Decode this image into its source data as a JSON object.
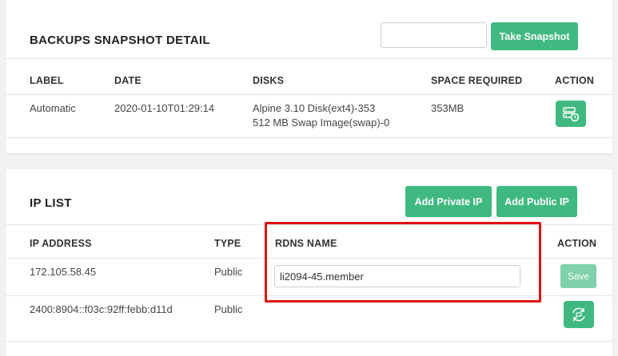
{
  "snapshot": {
    "title": "BACKUPS SNAPSHOT DETAIL",
    "input_value": "",
    "take_snapshot_label": "Take Snapshot",
    "columns": [
      "LABEL",
      "DATE",
      "DISKS",
      "SPACE REQUIRED",
      "ACTION"
    ],
    "rows": [
      {
        "label": "Automatic",
        "date": "2020-01-10T01:29:14",
        "disk_1": "Alpine 3.10 Disk(ext4)-353",
        "disk_2": "512 MB Swap Image(swap)-0",
        "space": "353MB",
        "action_icon": "restore-server-icon"
      }
    ]
  },
  "ip_list": {
    "title": "IP LIST",
    "add_private_label": "Add Private IP",
    "add_public_label": "Add Public IP",
    "columns": [
      "IP ADDRESS",
      "TYPE",
      "RDNS NAME",
      "ACTION"
    ],
    "rows": [
      {
        "ip": "172.105.58.45",
        "type": "Public",
        "rdns_value": "li2094-45.member",
        "save_label": "Save"
      },
      {
        "ip": "2400:8904::f03c:92ff:febb:d11d",
        "type": "Public",
        "action_icon": "refresh-icon"
      }
    ]
  },
  "colors": {
    "accent": "#3fb97f",
    "highlight": "#e01010",
    "background": "#f1f1f1"
  }
}
